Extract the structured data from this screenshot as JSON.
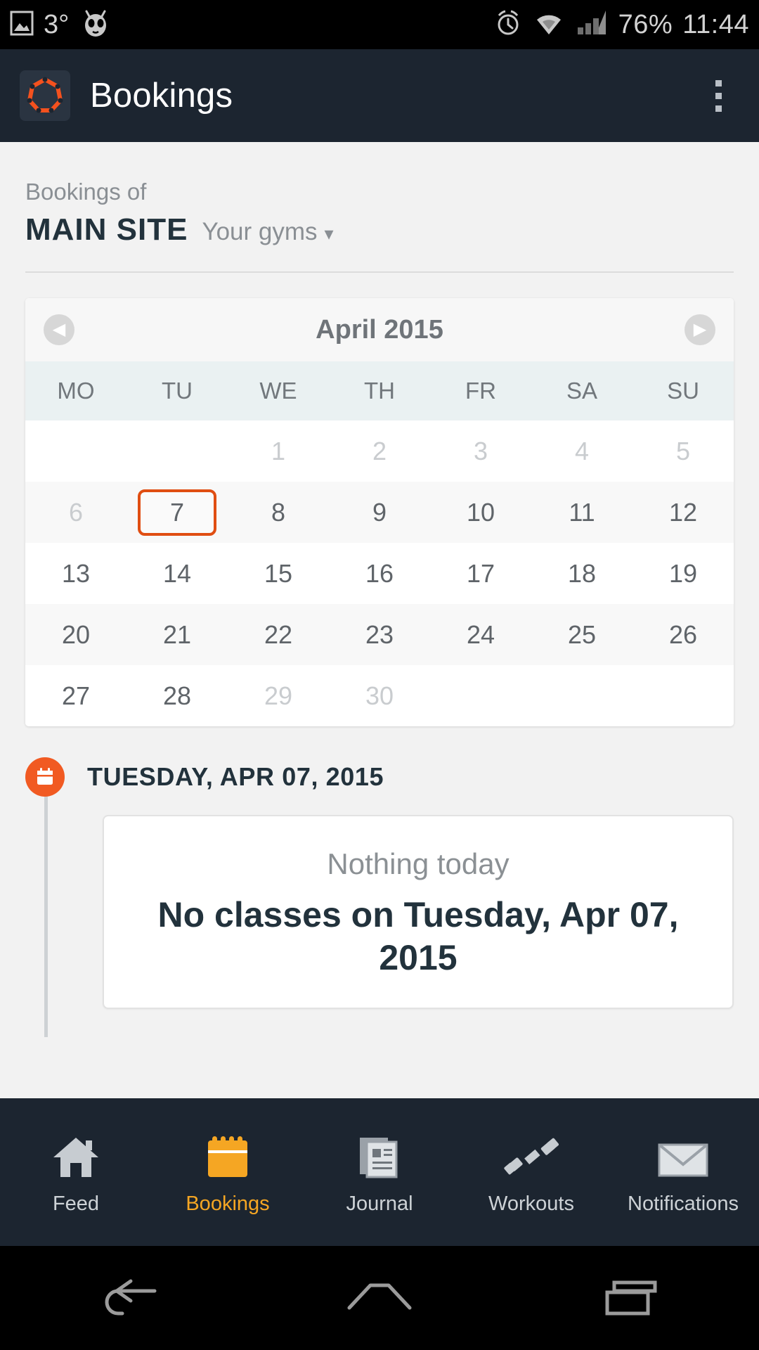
{
  "statusbar": {
    "temperature": "3°",
    "battery": "76%",
    "time": "11:44",
    "icons": [
      "gallery-icon",
      "cyanogenmod-icon",
      "alarm-icon",
      "wifi-icon",
      "signal-icon"
    ]
  },
  "appbar": {
    "title": "Bookings",
    "logo": "gym-polygon-logo",
    "overflow": "overflow-menu"
  },
  "site": {
    "prefix": "Bookings of",
    "name": "MAIN SITE",
    "switcher": "Your gyms",
    "caret": "▾"
  },
  "calendar": {
    "month_title": "April 2015",
    "prev": "◀",
    "next": "▶",
    "weekdays": [
      "MO",
      "TU",
      "WE",
      "TH",
      "FR",
      "SA",
      "SU"
    ],
    "selected_day": "7",
    "weeks": [
      [
        {
          "label": "",
          "state": "empty"
        },
        {
          "label": "",
          "state": "empty"
        },
        {
          "label": "1",
          "state": "muted"
        },
        {
          "label": "2",
          "state": "muted"
        },
        {
          "label": "3",
          "state": "muted"
        },
        {
          "label": "4",
          "state": "muted"
        },
        {
          "label": "5",
          "state": "muted"
        }
      ],
      [
        {
          "label": "6",
          "state": "muted"
        },
        {
          "label": "7",
          "state": "selected"
        },
        {
          "label": "8",
          "state": "normal"
        },
        {
          "label": "9",
          "state": "normal"
        },
        {
          "label": "10",
          "state": "normal"
        },
        {
          "label": "11",
          "state": "normal"
        },
        {
          "label": "12",
          "state": "normal"
        }
      ],
      [
        {
          "label": "13",
          "state": "normal"
        },
        {
          "label": "14",
          "state": "normal"
        },
        {
          "label": "15",
          "state": "normal"
        },
        {
          "label": "16",
          "state": "normal"
        },
        {
          "label": "17",
          "state": "normal"
        },
        {
          "label": "18",
          "state": "normal"
        },
        {
          "label": "19",
          "state": "normal"
        }
      ],
      [
        {
          "label": "20",
          "state": "normal"
        },
        {
          "label": "21",
          "state": "normal"
        },
        {
          "label": "22",
          "state": "normal"
        },
        {
          "label": "23",
          "state": "normal"
        },
        {
          "label": "24",
          "state": "normal"
        },
        {
          "label": "25",
          "state": "normal"
        },
        {
          "label": "26",
          "state": "normal"
        }
      ],
      [
        {
          "label": "27",
          "state": "normal"
        },
        {
          "label": "28",
          "state": "normal"
        },
        {
          "label": "29",
          "state": "muted"
        },
        {
          "label": "30",
          "state": "muted"
        },
        {
          "label": "",
          "state": "empty"
        },
        {
          "label": "",
          "state": "empty"
        },
        {
          "label": "",
          "state": "empty"
        }
      ]
    ]
  },
  "timeline": {
    "date_header": "TUESDAY, APR 07, 2015",
    "marker_icon": "calendar-icon",
    "card": {
      "subtitle": "Nothing today",
      "title": "No classes on Tuesday, Apr 07, 2015"
    }
  },
  "tabbar": {
    "items": [
      {
        "label": "Feed",
        "icon": "home-icon",
        "active": false
      },
      {
        "label": "Bookings",
        "icon": "calendar-icon",
        "active": true
      },
      {
        "label": "Journal",
        "icon": "notebook-icon",
        "active": false
      },
      {
        "label": "Workouts",
        "icon": "dumbbell-icon",
        "active": false
      },
      {
        "label": "Notifications",
        "icon": "envelope-icon",
        "active": false
      }
    ]
  },
  "sysnav": {
    "back": "back-icon",
    "home": "home-icon",
    "recents": "recents-icon"
  },
  "colors": {
    "accent_orange": "#f15a22",
    "selection_orange": "#e04e12",
    "tab_active": "#f5a623",
    "header_dark": "#1c2530",
    "text_dark": "#22323c"
  }
}
